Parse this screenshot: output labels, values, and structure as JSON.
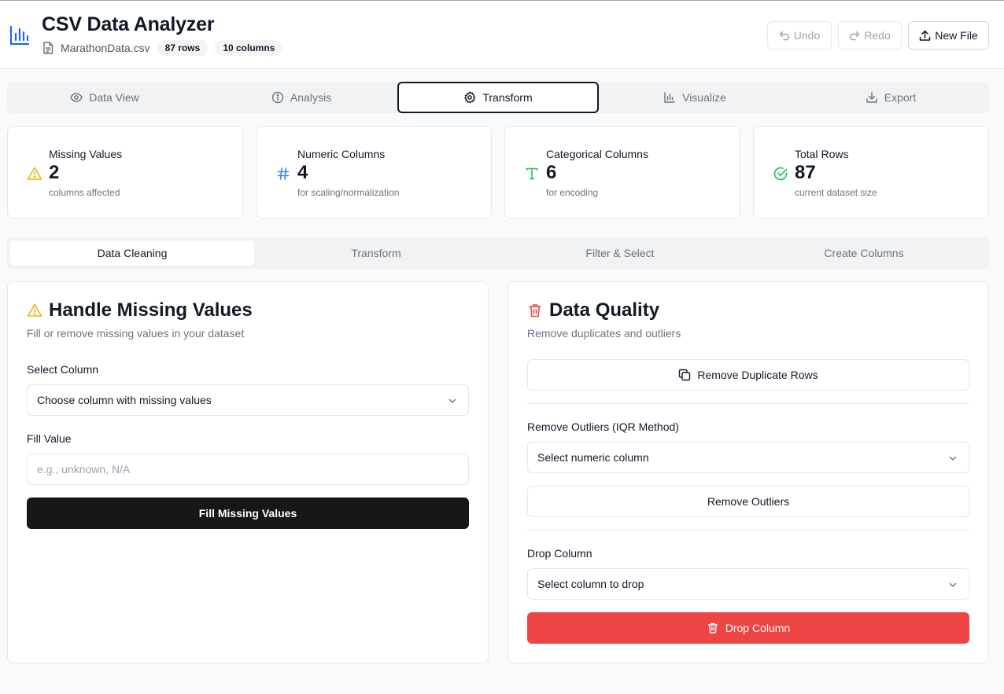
{
  "header": {
    "title": "CSV Data Analyzer",
    "file_name": "MarathonData.csv",
    "rows_badge": "87 rows",
    "columns_badge": "10 columns",
    "undo_label": "Undo",
    "redo_label": "Redo",
    "new_file_label": "New File"
  },
  "main_tabs": [
    {
      "label": "Data View",
      "icon": "eye-icon"
    },
    {
      "label": "Analysis",
      "icon": "info-icon"
    },
    {
      "label": "Transform",
      "icon": "gear-icon",
      "active": true
    },
    {
      "label": "Visualize",
      "icon": "bar-chart-icon"
    },
    {
      "label": "Export",
      "icon": "download-icon"
    }
  ],
  "stats": [
    {
      "label": "Missing Values",
      "value": "2",
      "sub": "columns affected",
      "icon": "warning-icon",
      "color": "#eab308"
    },
    {
      "label": "Numeric Columns",
      "value": "4",
      "sub": "for scaling/normalization",
      "icon": "hash-icon",
      "color": "#3b82f6"
    },
    {
      "label": "Categorical Columns",
      "value": "6",
      "sub": "for encoding",
      "icon": "type-icon",
      "color": "#22c55e"
    },
    {
      "label": "Total Rows",
      "value": "87",
      "sub": "current dataset size",
      "icon": "check-circle-icon",
      "color": "#22c55e"
    }
  ],
  "sub_tabs": [
    {
      "label": "Data Cleaning",
      "active": true
    },
    {
      "label": "Transform"
    },
    {
      "label": "Filter & Select"
    },
    {
      "label": "Create Columns"
    }
  ],
  "missing_panel": {
    "title": "Handle Missing Values",
    "description": "Fill or remove missing values in your dataset",
    "select_label": "Select Column",
    "select_value": "Choose column with missing values",
    "fill_label": "Fill Value",
    "fill_placeholder": "e.g., unknown, N/A",
    "fill_button": "Fill Missing Values"
  },
  "quality_panel": {
    "title": "Data Quality",
    "description": "Remove duplicates and outliers",
    "remove_duplicates": "Remove Duplicate Rows",
    "outliers_label": "Remove Outliers (IQR Method)",
    "outliers_select": "Select numeric column",
    "remove_outliers": "Remove Outliers",
    "drop_label": "Drop Column",
    "drop_select": "Select column to drop",
    "drop_button": "Drop Column"
  },
  "colors": {
    "accent_dark": "#171717",
    "danger": "#ef4444",
    "warning": "#eab308",
    "info": "#3b82f6",
    "success": "#22c55e"
  }
}
